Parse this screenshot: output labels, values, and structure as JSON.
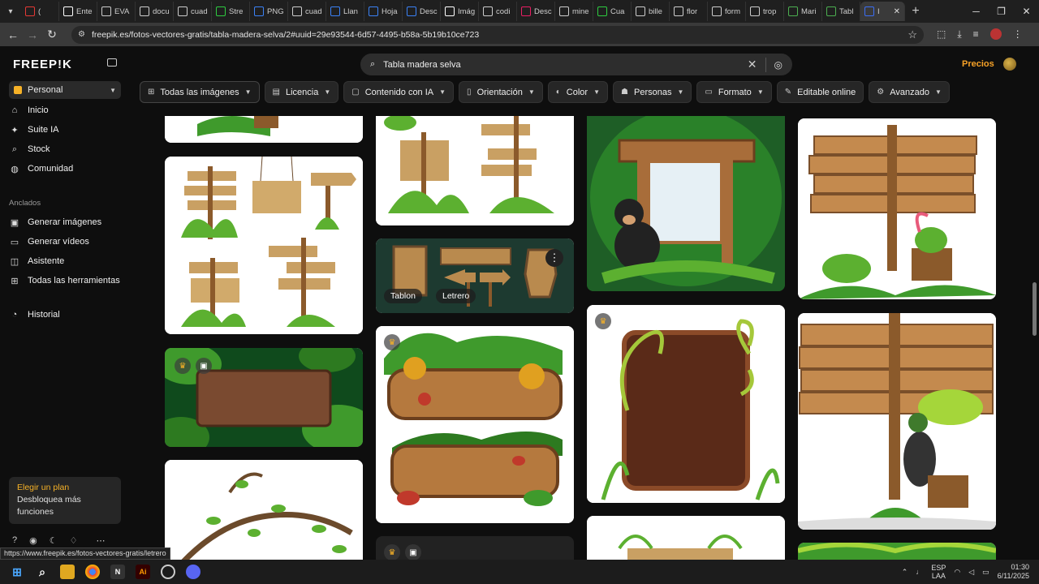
{
  "browser": {
    "tabs": [
      {
        "label": "(",
        "fav": "youtube-icon",
        "color": "#e53935"
      },
      {
        "label": "Ente",
        "fav": "chrome-icon",
        "color": "#ffffff"
      },
      {
        "label": "EVA",
        "fav": "document-icon",
        "color": "#cccccc"
      },
      {
        "label": "docu",
        "fav": "globe-icon",
        "color": "#cccccc"
      },
      {
        "label": "cuad",
        "fav": "globe-icon",
        "color": "#cccccc"
      },
      {
        "label": "Stre",
        "fav": "k-icon",
        "color": "#2ecc40"
      },
      {
        "label": "PNG",
        "fav": "m-icon",
        "color": "#3b82f6"
      },
      {
        "label": "cuad",
        "fav": "globe-icon",
        "color": "#cccccc"
      },
      {
        "label": "Llan",
        "fav": "m-icon",
        "color": "#3b82f6"
      },
      {
        "label": "Hoja",
        "fav": "m-icon",
        "color": "#3b82f6"
      },
      {
        "label": "Desc",
        "fav": "m-icon",
        "color": "#3b82f6"
      },
      {
        "label": "Imág",
        "fav": "star-icon",
        "color": "#ffffff"
      },
      {
        "label": "codi",
        "fav": "globe-icon",
        "color": "#cccccc"
      },
      {
        "label": "Desc",
        "fav": "drop-icon",
        "color": "#e91e63"
      },
      {
        "label": "mine",
        "fav": "globe-icon",
        "color": "#cccccc"
      },
      {
        "label": "Cua",
        "fav": "sheet-icon",
        "color": "#2ecc40"
      },
      {
        "label": "bille",
        "fav": "globe-icon",
        "color": "#cccccc"
      },
      {
        "label": "flor",
        "fav": "globe-icon",
        "color": "#cccccc"
      },
      {
        "label": "form",
        "fav": "globe-icon",
        "color": "#cccccc"
      },
      {
        "label": "trop",
        "fav": "globe-icon",
        "color": "#cccccc"
      },
      {
        "label": "Mari",
        "fav": "globe-icon",
        "color": "#4caf50"
      },
      {
        "label": "Tabl",
        "fav": "globe-icon",
        "color": "#4caf50"
      },
      {
        "label": "I",
        "fav": "freepik-icon",
        "color": "#3b6ef5",
        "active": true
      }
    ],
    "url": "freepik.es/fotos-vectores-gratis/tabla-madera-selva/2#uuid=29e93544-6d57-4495-b58a-5b19b10ce723",
    "status_url": "https://www.freepik.es/fotos-vectores-gratis/letrero"
  },
  "sidebar": {
    "logo": "FREEP!K",
    "workspace": "Personal",
    "nav": [
      "Inicio",
      "Suite IA",
      "Stock",
      "Comunidad"
    ],
    "pinned_label": "Anclados",
    "pinned": [
      "Generar imágenes",
      "Generar vídeos",
      "Asistente",
      "Todas las herramientas"
    ],
    "history": "Historial",
    "plan_title": "Elegir un plan",
    "plan_desc": "Desbloquea más funciones"
  },
  "header": {
    "search_value": "Tabla madera selva",
    "pricing": "Precios"
  },
  "filters": [
    "Todas las imágenes",
    "Licencia",
    "Contenido con IA",
    "Orientación",
    "Color",
    "Personas",
    "Formato",
    "Editable online",
    "Avanzado"
  ],
  "results": {
    "hover_tags": [
      "Tablon",
      "Letrero"
    ]
  },
  "taskbar": {
    "lang1": "ESP",
    "lang2": "LAA",
    "time": "01:30",
    "date": "6/11/2025"
  },
  "colors": {
    "accent": "#f7a227",
    "wood": "#b98a4e",
    "leaf": "#3f9a2c"
  }
}
